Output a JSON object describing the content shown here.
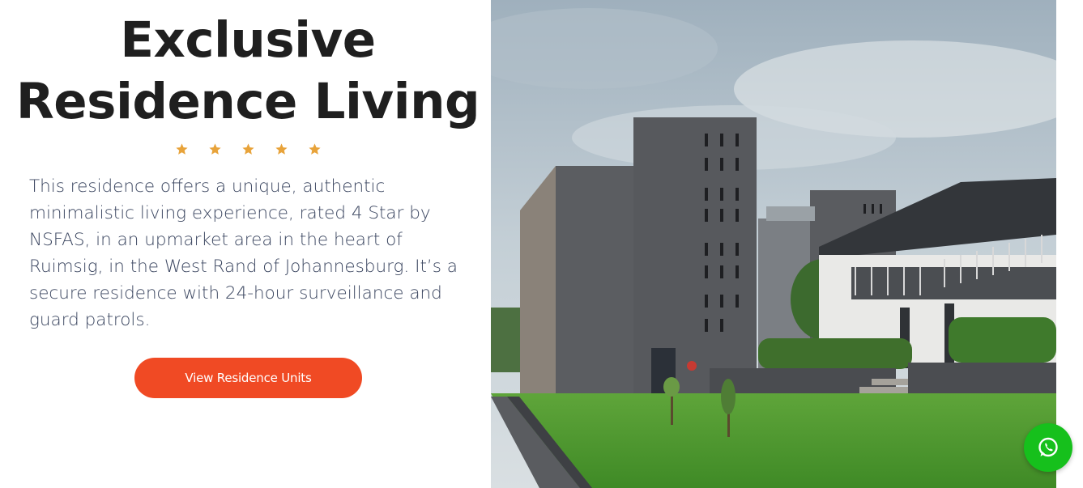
{
  "hero": {
    "title_line1": "Exclusive",
    "title_line2": "Residence Living",
    "rating": {
      "value": 5,
      "max": 5,
      "color": "#e8a33a"
    },
    "description": "This residence offers a unique, authentic minimalistic living experience, rated 4 Star by NSFAS, in an upmarket area in the heart of Ruimsig, in the West Rand of Johannesburg. It’s a secure residence with 24-hour surveillance and guard patrols.",
    "cta_label": "View Residence Units",
    "cta_color": "#f04a24"
  },
  "photo": {
    "subject": "residence-building-photo"
  },
  "floating": {
    "whatsapp_icon": "whatsapp-icon",
    "whatsapp_color": "#16c01c"
  }
}
